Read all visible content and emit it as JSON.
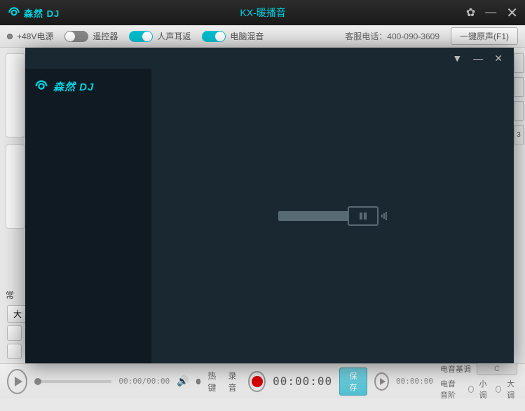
{
  "titlebar": {
    "logo_text": "森然 DJ",
    "title": "KX-暖播音"
  },
  "toolbar": {
    "power_label": "+48V电源",
    "remote_label": "遥控器",
    "voice_return_label": "人声耳返",
    "pc_mix_label": "电脑混音",
    "phone": "客服电话：400-090-3609",
    "onekey_label": "一键原声(F1)"
  },
  "left": {
    "section_title": "常",
    "btn1": "大"
  },
  "right_tab": "3",
  "bottom": {
    "play_time": "00:00/00:00",
    "hotkey_label": "热键",
    "rec_label": "录音",
    "rec_time": "00:00:00",
    "save_label": "保存",
    "rec_time2": "00:00:00",
    "tune_title": "电音基调",
    "tune_value": "C",
    "tune_scale": "电音音阶",
    "minor": "小调",
    "major": "大调"
  },
  "overlay": {
    "logo_text": "森然 DJ"
  }
}
